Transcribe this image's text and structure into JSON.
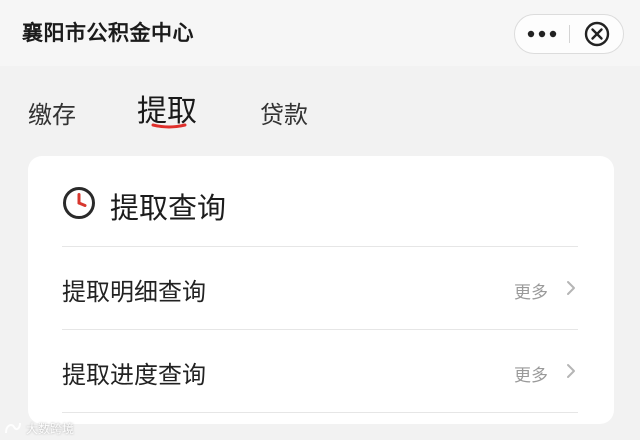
{
  "app": {
    "title": "襄阳市公积金中心"
  },
  "capsule": {
    "more_icon": "more-dots-icon",
    "close_icon": "close-circle-icon"
  },
  "tabs": [
    {
      "label": "缴存",
      "active": false
    },
    {
      "label": "提取",
      "active": true
    },
    {
      "label": "贷款",
      "active": false
    }
  ],
  "card": {
    "title": "提取查询",
    "icon": "clock-icon",
    "rows": [
      {
        "label": "提取明细查询",
        "more": "更多"
      },
      {
        "label": "提取进度查询",
        "more": "更多"
      }
    ]
  },
  "watermark": {
    "text": "大数跨境"
  },
  "colors": {
    "active_indicator": "#e0302c",
    "background": "#f2f2f2",
    "card": "#ffffff",
    "secondary_text": "#9a9a9a"
  }
}
